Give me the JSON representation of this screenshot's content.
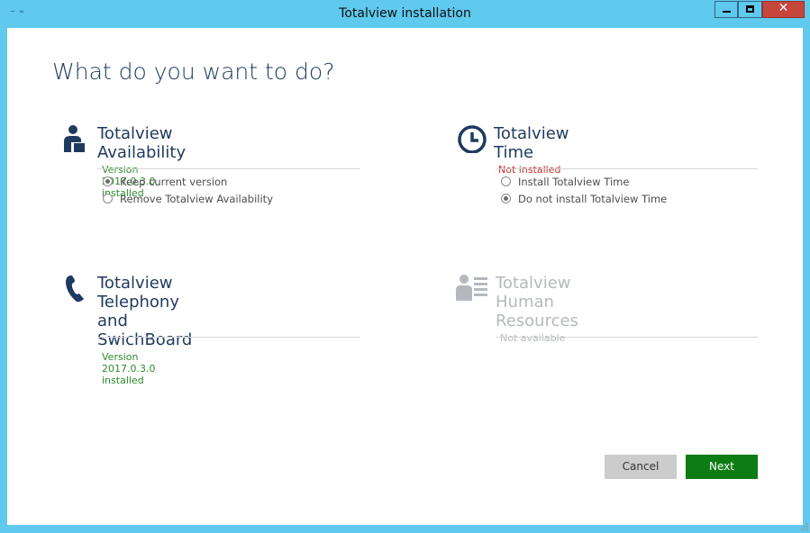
{
  "window": {
    "title": "Totalview installation",
    "system_icon_text": "~ ∞",
    "controls": {
      "minimize": "",
      "maximize": "",
      "close": "✕"
    }
  },
  "page": {
    "heading": "What do you want to do?"
  },
  "sections": {
    "availability": {
      "title": "Totalview Availability",
      "status": "Version 2017.0.3.0 installed",
      "icon": "person-desk-icon",
      "options": [
        {
          "label": "Keep current version",
          "selected": true
        },
        {
          "label": "Remove Totalview Availability",
          "selected": false
        }
      ]
    },
    "time": {
      "title": "Totalview Time",
      "status": "Not installed",
      "icon": "clock-icon",
      "options": [
        {
          "label": "Install Totalview Time",
          "selected": false
        },
        {
          "label": "Do not install Totalview Time",
          "selected": true
        }
      ]
    },
    "telephony": {
      "title_line1": "Totalview Telephony",
      "title_line2": "and SwichBoard",
      "status": "Version 2017.0.3.0 installed",
      "icon": "phone-icon"
    },
    "hr": {
      "title_line1": "Totalview Human",
      "title_line2": "Resources",
      "status": "Not available",
      "icon": "person-list-icon"
    }
  },
  "buttons": {
    "cancel": "Cancel",
    "next": "Next"
  },
  "colors": {
    "titlebar": "#5fc9ee",
    "heading": "#1e3a5f",
    "installed": "#2e8b2e",
    "not_installed": "#cc2b2b",
    "disabled": "#b5b9bd",
    "next_button": "#0e7c14",
    "close_button": "#c7463b"
  }
}
